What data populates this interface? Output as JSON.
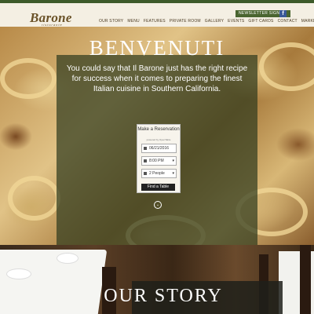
{
  "header": {
    "logo_text": "Barone",
    "logo_sub": "ristorante",
    "newsletter_label": "NEWSLETTER SIGN UP",
    "facebook_icon": "facebook-icon",
    "nav": [
      "OUR STORY",
      "MENU",
      "FEATURES",
      "PRIVATE ROOM",
      "GALLERY",
      "EVENTS",
      "GIFT CARDS",
      "CONTACT",
      "MARKET"
    ]
  },
  "hero": {
    "title": "BENVENUTI",
    "intro": "You could say that Il Barone just has the right recipe for success when it comes to preparing the finest Italian cuisine in Southern California."
  },
  "reservation": {
    "title": "Make a Reservation",
    "subtitle": "powered by OpenTable",
    "date": "06/21/2016",
    "time": "8:00 PM",
    "party": "2 People",
    "button": "Find a Table"
  },
  "story": {
    "title": "OUR STORY"
  },
  "colors": {
    "accent_green": "#4a6530",
    "panel": "#303c1e",
    "header_bg": "#f4efe3"
  }
}
